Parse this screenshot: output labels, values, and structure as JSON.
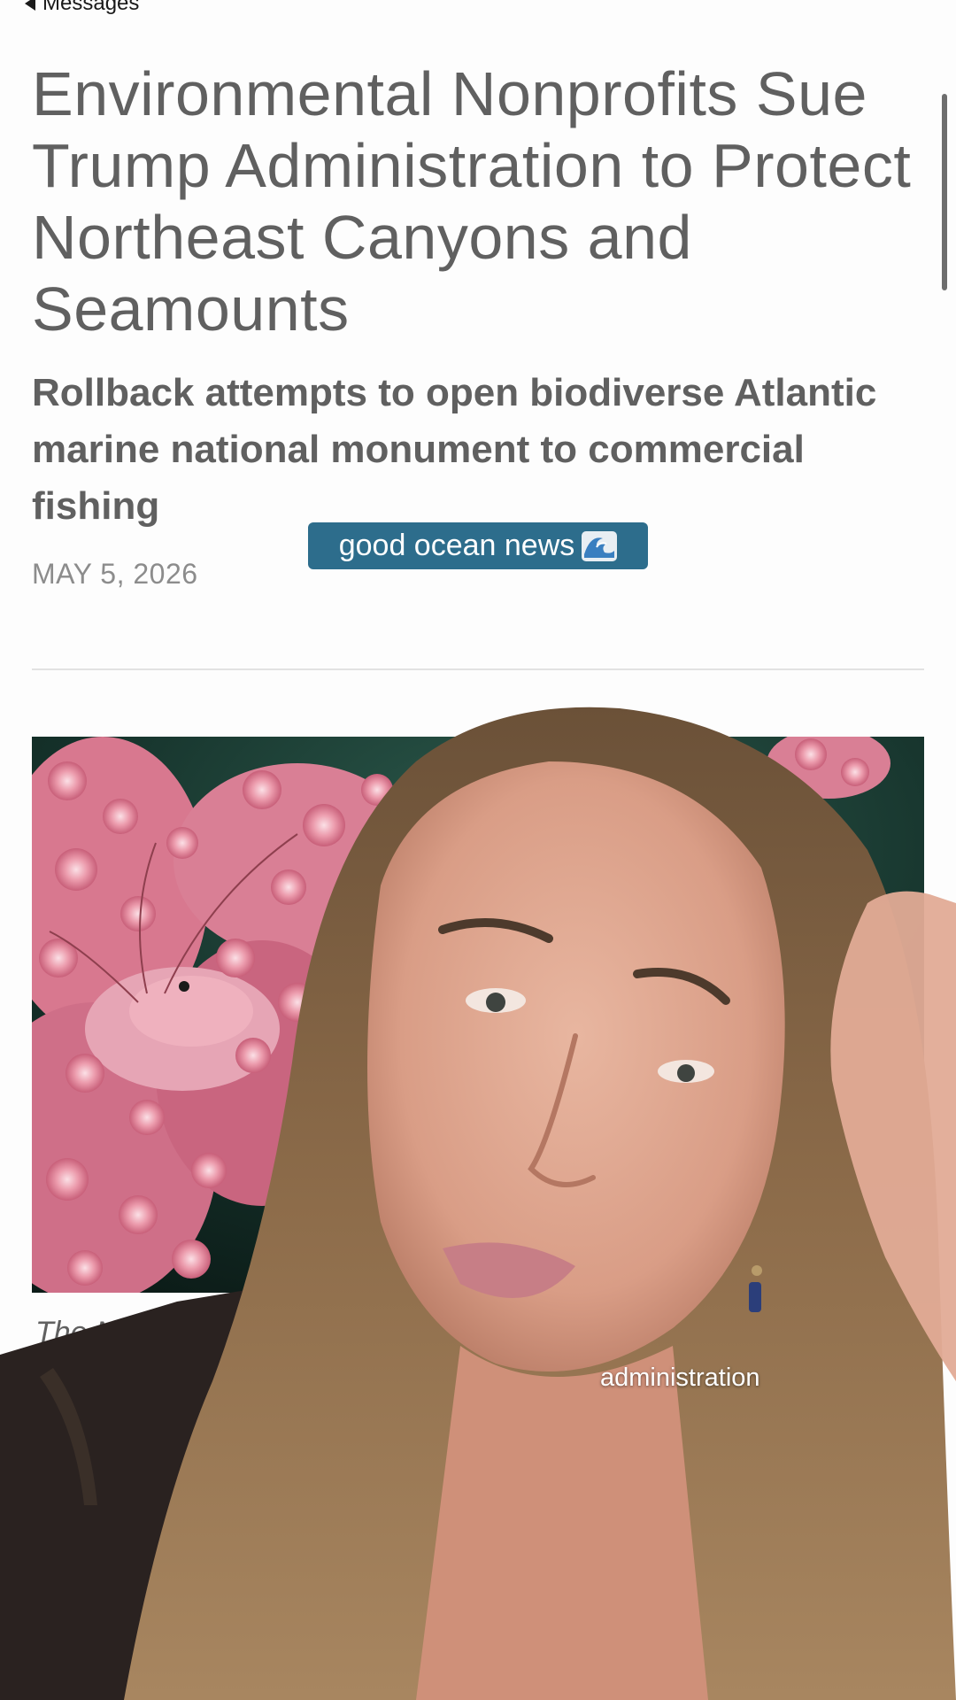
{
  "nav": {
    "back_label": "Messages"
  },
  "article": {
    "headline": "Environmental Nonprofits Sue Trump Administration to Protect Northeast Canyons and Seamounts",
    "subhead": "Rollback attempts to open biodiverse Atlantic marine national monument to commercial fishing",
    "date": "MAY 5, 2026",
    "image_caption": "The No"
  },
  "overlay": {
    "sticker_text": "good ocean news",
    "sticker_icon": "wave-icon",
    "speech_caption": "administration"
  },
  "colors": {
    "text_gray": "#606060",
    "date_gray": "#8c8c8c",
    "chip_blue": "#2d6d8c",
    "coral_pink": "#e9879c",
    "water_green": "#1d3b33"
  }
}
